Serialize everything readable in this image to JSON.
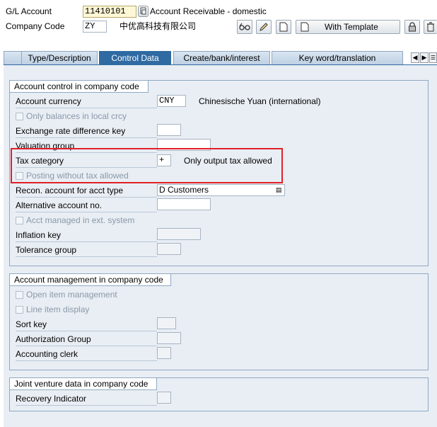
{
  "header": {
    "gl_account_label": "G/L Account",
    "gl_account_value": "11410101",
    "gl_account_desc": "Account Receivable - domestic",
    "company_code_label": "Company Code",
    "company_code_value": "ZY",
    "company_name": "中优高科技有限公司"
  },
  "toolbar": {
    "with_template_label": "With Template"
  },
  "tabs": [
    {
      "label": "Type/Description"
    },
    {
      "label": "Control Data"
    },
    {
      "label": "Create/bank/interest"
    },
    {
      "label": "Key word/translation"
    }
  ],
  "account_control": {
    "title": "Account control in company code",
    "account_currency_label": "Account currency",
    "account_currency_value": "CNY",
    "account_currency_desc": "Chinesische Yuan (international)",
    "only_balances_label": "Only balances in local crcy",
    "exchange_rate_label": "Exchange rate difference key",
    "valuation_group_label": "Valuation group",
    "tax_category_label": "Tax category",
    "tax_category_value": "+",
    "tax_category_desc": "Only output tax allowed",
    "posting_without_tax_label": "Posting without tax allowed",
    "recon_account_label": "Recon. account for acct type",
    "recon_account_value": "D Customers",
    "alternative_account_label": "Alternative account no.",
    "acct_managed_label": "Acct managed in ext. system",
    "inflation_key_label": "Inflation key",
    "tolerance_group_label": "Tolerance group"
  },
  "account_management": {
    "title": "Account management in company code",
    "open_item_label": "Open item management",
    "line_item_label": "Line item display",
    "sort_key_label": "Sort key",
    "authorization_group_label": "Authorization Group",
    "accounting_clerk_label": "Accounting clerk"
  },
  "joint_venture": {
    "title": "Joint venture data in company code",
    "recovery_indicator_label": "Recovery Indicator"
  },
  "colors": {
    "active_tab": "#2f6aa3",
    "highlight_box": "#e0202a",
    "panel_bg": "#e9eef4"
  }
}
